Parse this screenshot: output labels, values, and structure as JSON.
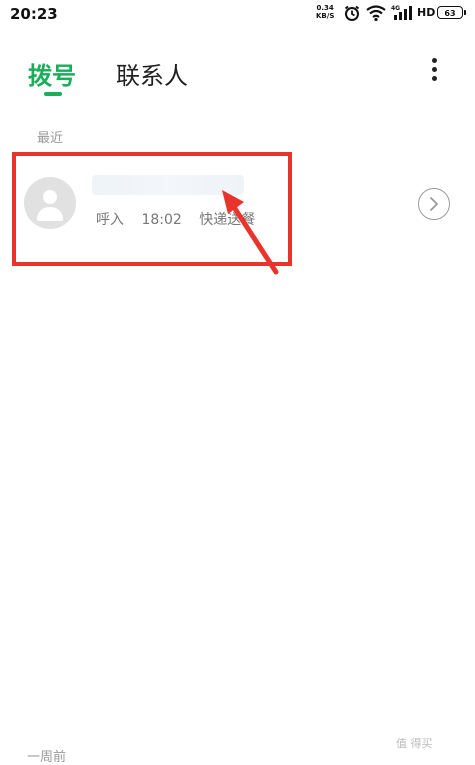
{
  "status_bar": {
    "time": "20:23",
    "speed_value": "0.34",
    "speed_unit": "KB/S",
    "network_label": "4G",
    "hd_label": "HD",
    "battery": "63"
  },
  "tabs": {
    "dial": "拨号",
    "contacts": "联系人"
  },
  "sections": {
    "recent": "最近",
    "week_ago": "一周前"
  },
  "call_log": [
    {
      "direction": "呼入",
      "time": "18:02",
      "tag": "快递送餐"
    }
  ],
  "watermark": "值 得买"
}
